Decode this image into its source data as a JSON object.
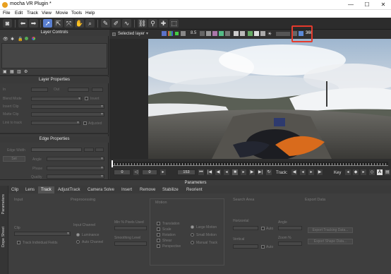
{
  "window": {
    "title": "mocha VR Plugin *",
    "controls": [
      "—",
      "☐",
      "✕"
    ]
  },
  "menu": [
    "File",
    "Edit",
    "Track",
    "View",
    "Movie",
    "Tools",
    "Help"
  ],
  "layer_controls": {
    "title": "Layer Controls"
  },
  "layer_properties": {
    "title": "Layer Properties",
    "in_label": "In",
    "out_label": "Out",
    "blend_mode_label": "Blend Mode",
    "invert_label": "Invert",
    "insert_clip_label": "Insert Clip",
    "matte_clip_label": "Matte Clip",
    "link_to_track_label": "Link to track",
    "adjusted_label": "Adjusted"
  },
  "edge_properties": {
    "title": "Edge Properties",
    "edge_width_label": "Edge Width",
    "set_label": "Set",
    "angle_label": "Angle",
    "phase_label": "Phase",
    "quality_label": "Quality"
  },
  "viewer_toolbar": {
    "selected_layer": "Selected layer",
    "zoom_value": "8.5",
    "degrees": "360"
  },
  "timeline": {
    "in_frame": "0",
    "current_frame": "153",
    "out_frame": "0",
    "track_label": "Track:",
    "key_label": "Key"
  },
  "parameters": {
    "title": "Parameters",
    "side_tabs": [
      "Parameters",
      "Dope Sheet"
    ],
    "tabs": [
      "Clip",
      "Lens",
      "Track",
      "AdjustTrack",
      "Camera Solve",
      "Insert",
      "Remove",
      "Stabilize",
      "Reorient"
    ],
    "active_tab": "Track",
    "input": {
      "title": "Input",
      "clip_label": "Clip",
      "track_individual_fields": "Track Individual Fields"
    },
    "preprocessing": {
      "title": "Preprocessing",
      "input_channel": "Input Channel",
      "luminance": "Luminance",
      "auto_channel": "Auto Channel",
      "min_pixels_used": "Min % Pixels Used",
      "smoothing_level": "Smoothing Level"
    },
    "motion": {
      "title": "Motion",
      "translation": "Translation",
      "scale": "Scale",
      "rotation": "Rotation",
      "shear": "Shear",
      "perspective": "Perspective",
      "large_motion": "Large Motion",
      "small_motion": "Small Motion",
      "manual_track": "Manual Track"
    },
    "search_area": {
      "title": "Search Area",
      "horizontal": "Horizontal",
      "vertical": "Vertical",
      "auto": "Auto",
      "angle": "Angle",
      "zoom": "Zoom %"
    },
    "export_data": {
      "title": "Export Data",
      "export_tracking": "Export Tracking Data...",
      "export_shape": "Export Shape Data..."
    }
  }
}
